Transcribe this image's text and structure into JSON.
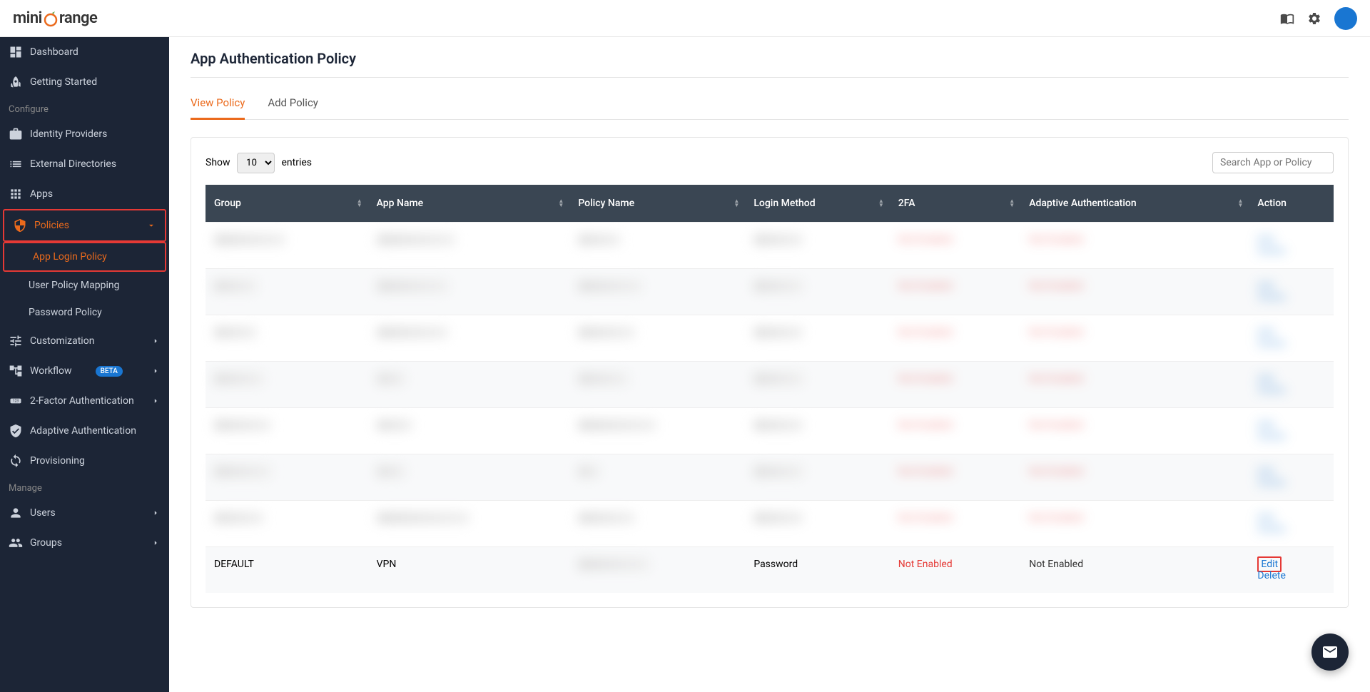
{
  "header": {
    "logo_mini": "mini",
    "logo_range": "range"
  },
  "sidebar": {
    "items": {
      "dashboard": "Dashboard",
      "getting_started": "Getting Started",
      "identity_providers": "Identity Providers",
      "external_directories": "External Directories",
      "apps": "Apps",
      "policies": "Policies",
      "app_login_policy": "App Login Policy",
      "user_policy_mapping": "User Policy Mapping",
      "password_policy": "Password Policy",
      "customization": "Customization",
      "workflow": "Workflow",
      "two_factor": "2-Factor Authentication",
      "adaptive_auth": "Adaptive Authentication",
      "provisioning": "Provisioning",
      "users": "Users",
      "groups": "Groups"
    },
    "sections": {
      "configure": "Configure",
      "manage": "Manage"
    },
    "badges": {
      "beta": "BETA"
    }
  },
  "main": {
    "title": "App Authentication Policy",
    "tabs": {
      "view_policy": "View Policy",
      "add_policy": "Add Policy"
    },
    "table_controls": {
      "show": "Show",
      "entries": "entries",
      "count": "10",
      "search_placeholder": "Search App or Policy"
    },
    "columns": {
      "group": "Group",
      "app_name": "App Name",
      "policy_name": "Policy Name",
      "login_method": "Login Method",
      "two_fa": "2FA",
      "adaptive_auth": "Adaptive Authentication",
      "action": "Action"
    },
    "visible_row": {
      "group": "DEFAULT",
      "app_name": "VPN",
      "policy_name": "",
      "login_method": "Password",
      "two_fa": "Not Enabled",
      "adaptive_auth": "Not Enabled",
      "action_edit": "Edit",
      "action_delete": "Delete"
    },
    "blurred_values": {
      "not_enabled": "Not Enabled",
      "edit": "Edit",
      "delete": "Delete"
    }
  }
}
